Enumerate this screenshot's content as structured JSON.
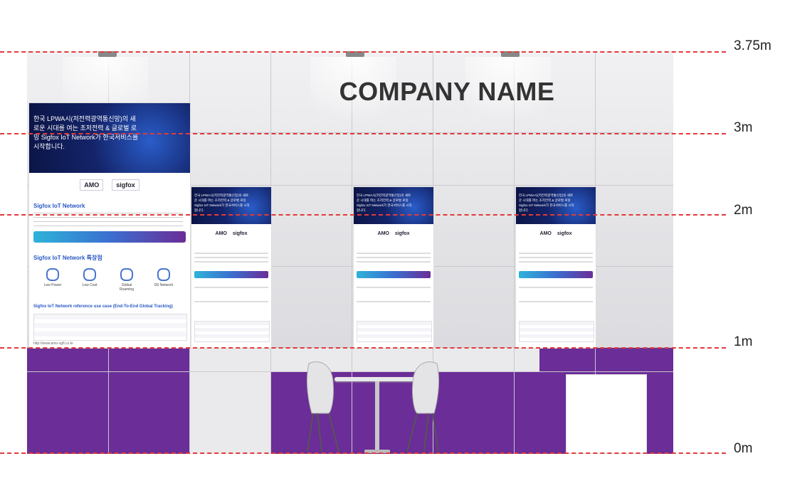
{
  "company_name": "COMPANY NAME",
  "height_markers": [
    "3.75m",
    "3m",
    "2m",
    "1m",
    "0m"
  ],
  "poster": {
    "headline": "한국 LPWA시(저전력광역통신망)의 새로운 시대를 여는 초저전력 & 글로벌 로밍 Sigfox IoT Network가 한국서비스를 시작합니다.",
    "logo_amo": "AMO",
    "logo_sigfox": "sigfox",
    "section1_title": "Sigfox IoT Network",
    "section2_title": "Sigfox IoT Network 특장점",
    "features": [
      "Low Power",
      "Low Cost",
      "Global Roaming",
      "0G Network"
    ],
    "section3_title": "Sigfox IoT Network reference use case (End-To-End Global Tracking)",
    "url": "http://www.amo-sgfl.co.kr"
  },
  "colors": {
    "accent_purple": "#6b2d97",
    "accent_blue": "#2a58c4",
    "guide_red": "#e23a3a"
  }
}
